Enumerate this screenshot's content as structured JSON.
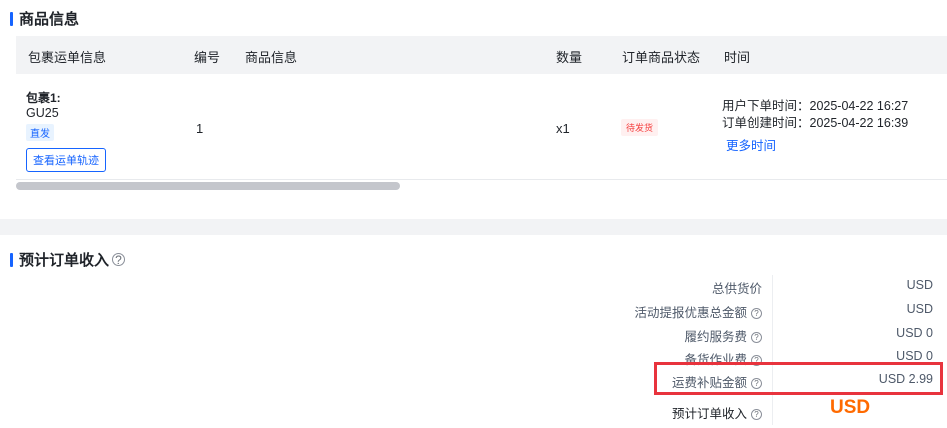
{
  "product_section": {
    "title": "商品信息",
    "columns": [
      "包裹运单信息",
      "编号",
      "商品信息",
      "数量",
      "订单商品状态",
      "时间"
    ],
    "row": {
      "package_title": "包裹1:",
      "package_code": "GU25",
      "ship_tag": "直发",
      "track_button": "查看运单轨迹",
      "number": "1",
      "quantity": "x1",
      "status": "待发货",
      "user_order_time": "用户下单时间：2025-04-22 16:27",
      "order_create_time": "订单创建时间：2025-04-22 16:39",
      "more_time_link": "更多时间"
    },
    "scrollbar": {
      "position": 0.41
    }
  },
  "income_section": {
    "title": "预计订单收入",
    "help_icon": "question-circle-icon",
    "rows": [
      {
        "label": "总供货价",
        "value": "USD"
      },
      {
        "label": "活动提报优惠总金额",
        "value": "USD",
        "help": true
      },
      {
        "label": "履约服务费",
        "value": "USD 0",
        "help": true
      },
      {
        "label": "备货作业费",
        "value": "USD 0",
        "help": true
      },
      {
        "label": "运费补贴金额",
        "value": "USD 2.99",
        "help": true
      }
    ],
    "total_label": "预计订单收入",
    "total_value": "USD",
    "highlight_color": "#e8333d",
    "total_color": "#ff6a00"
  },
  "colors": {
    "accent": "#1664ff",
    "status_red": "#f53f3f"
  }
}
